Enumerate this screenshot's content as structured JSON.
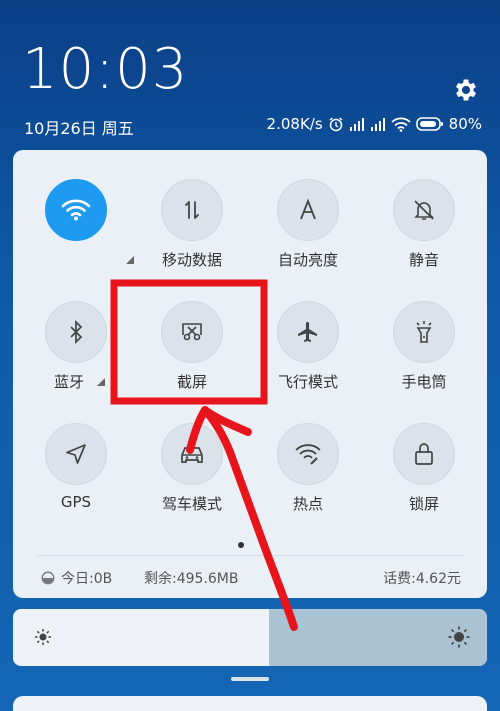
{
  "statusbar": {
    "time": "10:03",
    "date": "10月26日 周五",
    "speed": "2.08K/s",
    "battery": "80%"
  },
  "toggles": [
    {
      "label": "",
      "icon": "wifi-icon",
      "active": true
    },
    {
      "label": "移动数据",
      "icon": "mobile-data-icon",
      "active": false
    },
    {
      "label": "自动亮度",
      "icon": "auto-brightness-icon",
      "active": false
    },
    {
      "label": "静音",
      "icon": "mute-bell-icon",
      "active": false
    },
    {
      "label": "蓝牙",
      "icon": "bluetooth-icon",
      "active": false
    },
    {
      "label": "截屏",
      "icon": "screenshot-icon",
      "active": false
    },
    {
      "label": "飞行模式",
      "icon": "airplane-icon",
      "active": false
    },
    {
      "label": "手电筒",
      "icon": "flashlight-icon",
      "active": false
    },
    {
      "label": "GPS",
      "icon": "gps-icon",
      "active": false
    },
    {
      "label": "驾车模式",
      "icon": "car-icon",
      "active": false
    },
    {
      "label": "热点",
      "icon": "hotspot-icon",
      "active": false
    },
    {
      "label": "锁屏",
      "icon": "lock-icon",
      "active": false
    }
  ],
  "usage": {
    "today": "今日:0B",
    "remaining": "剩余:495.6MB",
    "fee": "话费:4.62元"
  },
  "brightness": {
    "level": 0.54
  },
  "colors": {
    "accent": "#1e9bf0",
    "highlight": "#e8141c"
  }
}
